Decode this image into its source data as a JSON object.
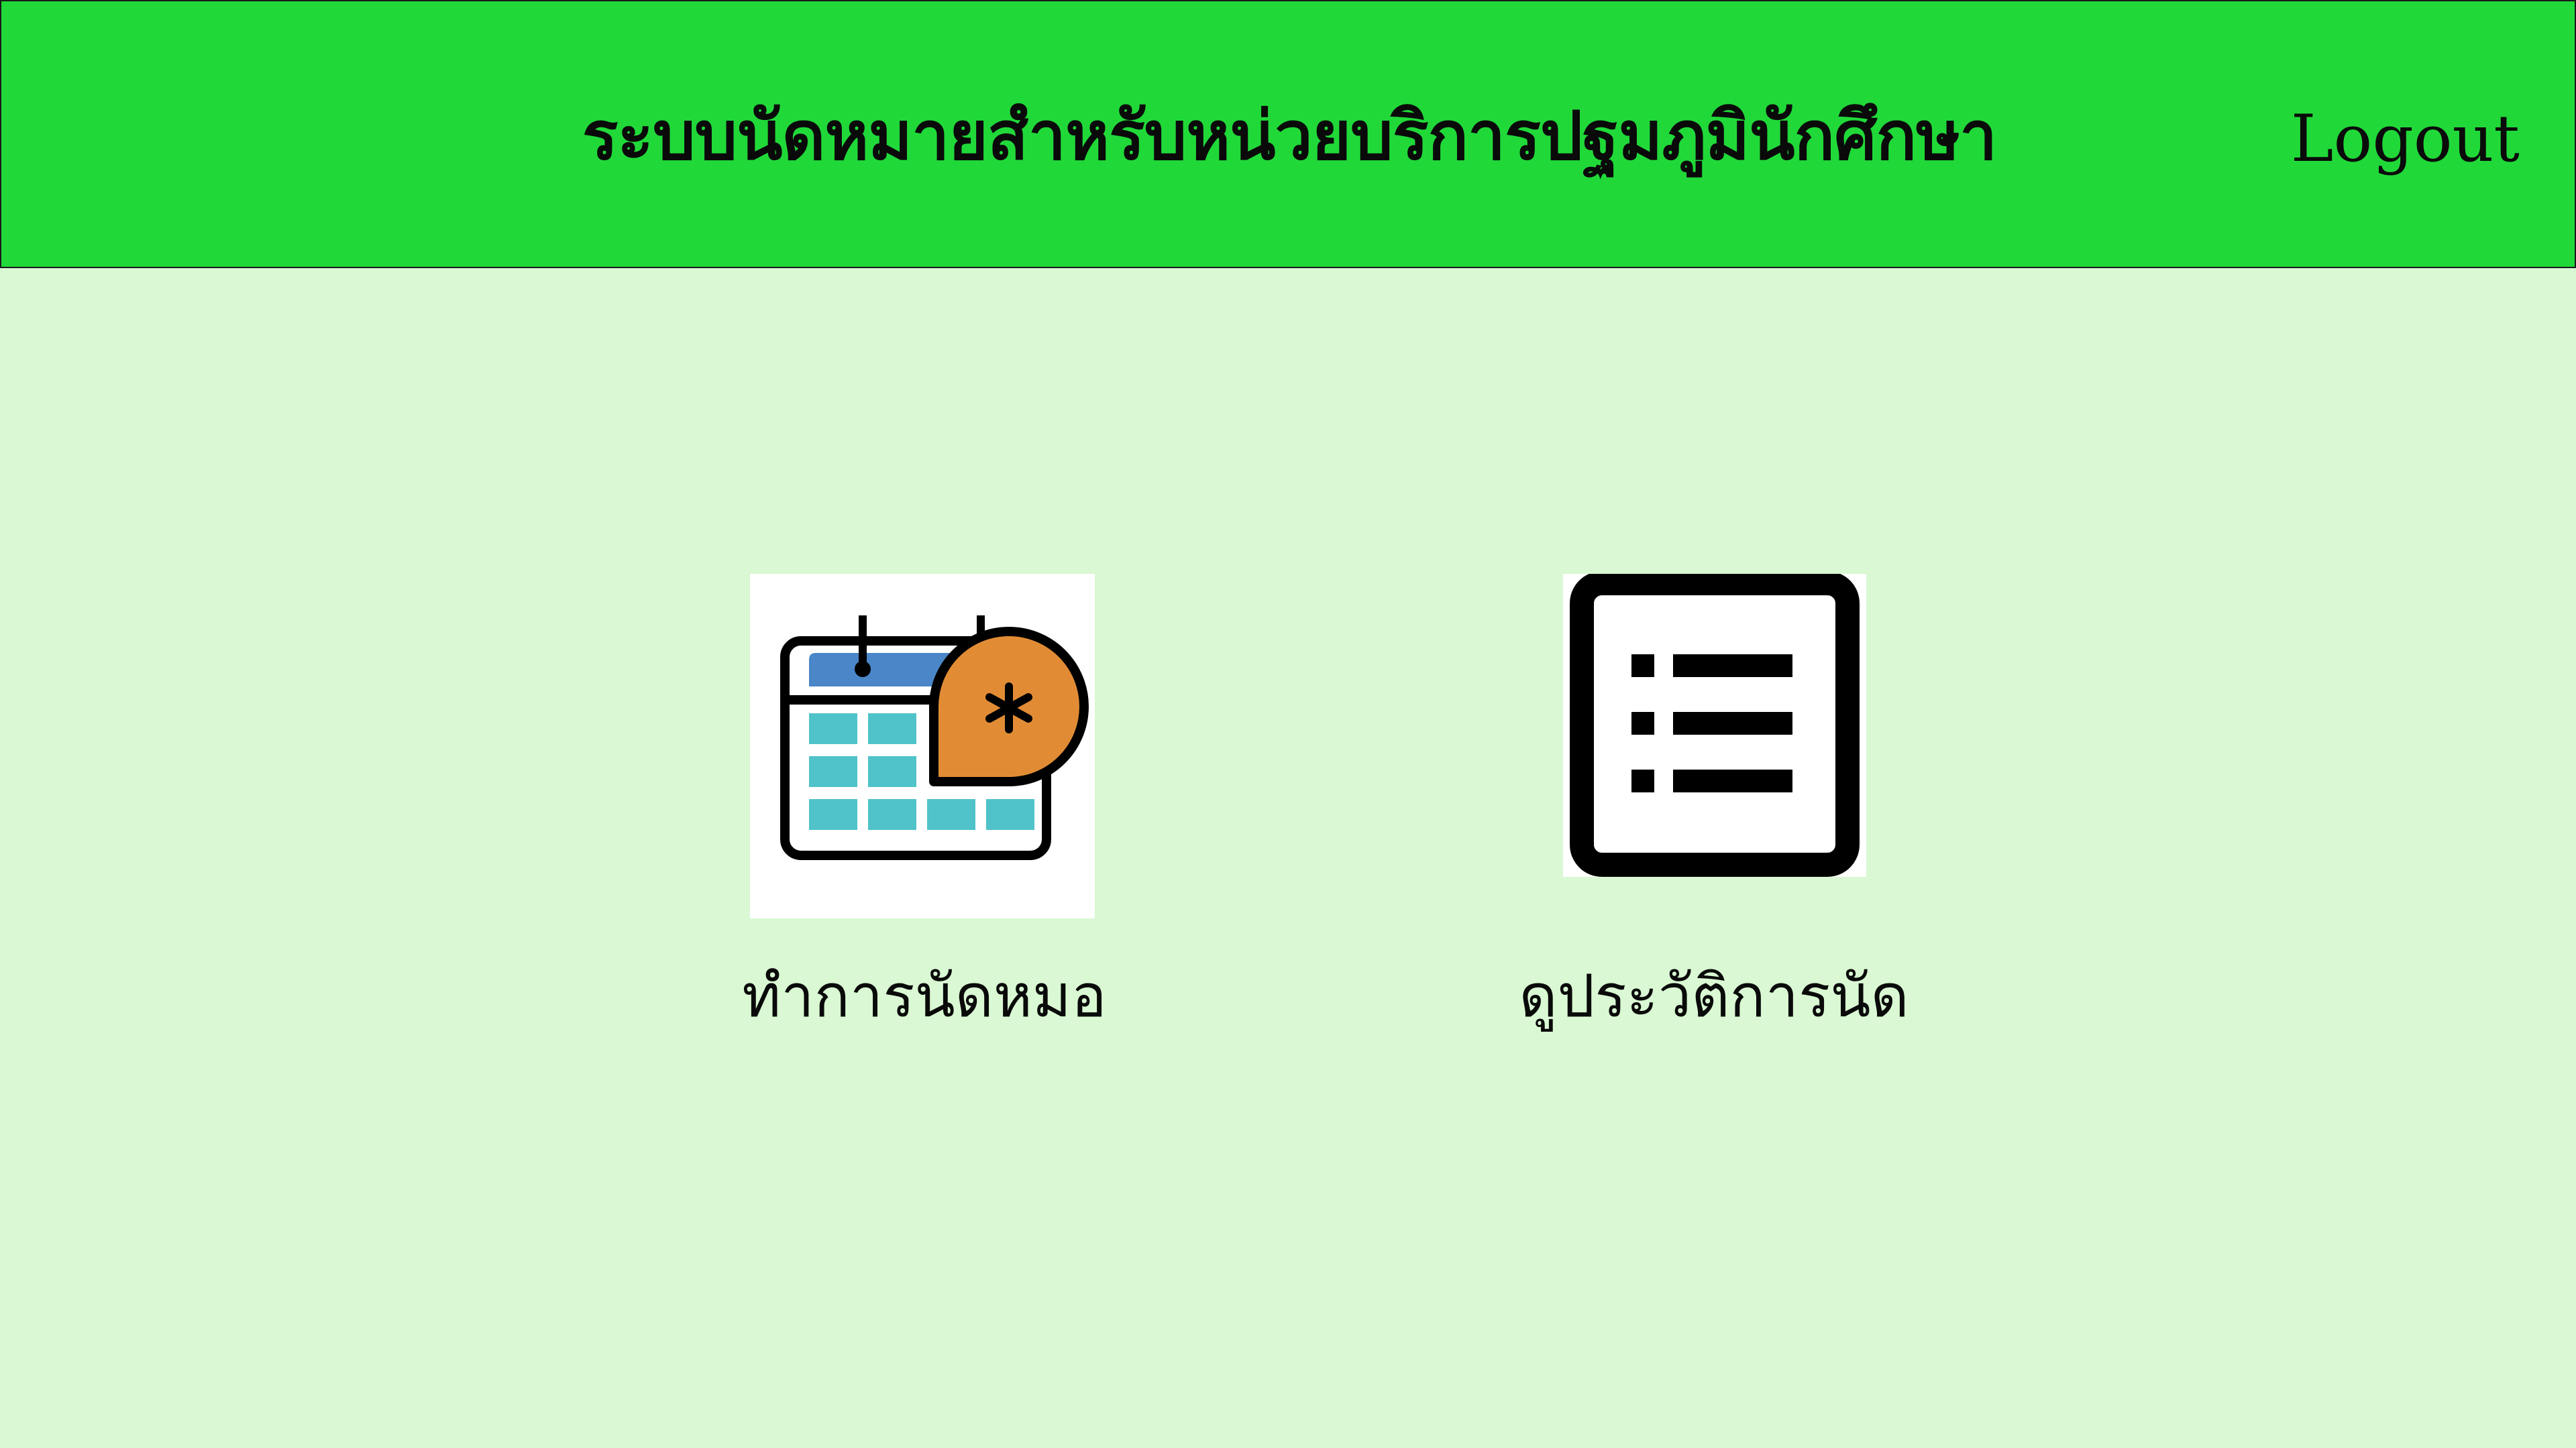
{
  "header": {
    "title": "ระบบนัดหมายสำหรับหน่วยบริการปฐมภูมินักศึกษา",
    "logout_label": "Logout",
    "background_color": "#20d939"
  },
  "page": {
    "background_color": "#d9f8d3"
  },
  "tiles": [
    {
      "label": "ทำการนัดหมอ",
      "icon": "calendar-appointment-icon"
    },
    {
      "label": "ดูประวัติการนัด",
      "icon": "list-document-icon"
    }
  ]
}
